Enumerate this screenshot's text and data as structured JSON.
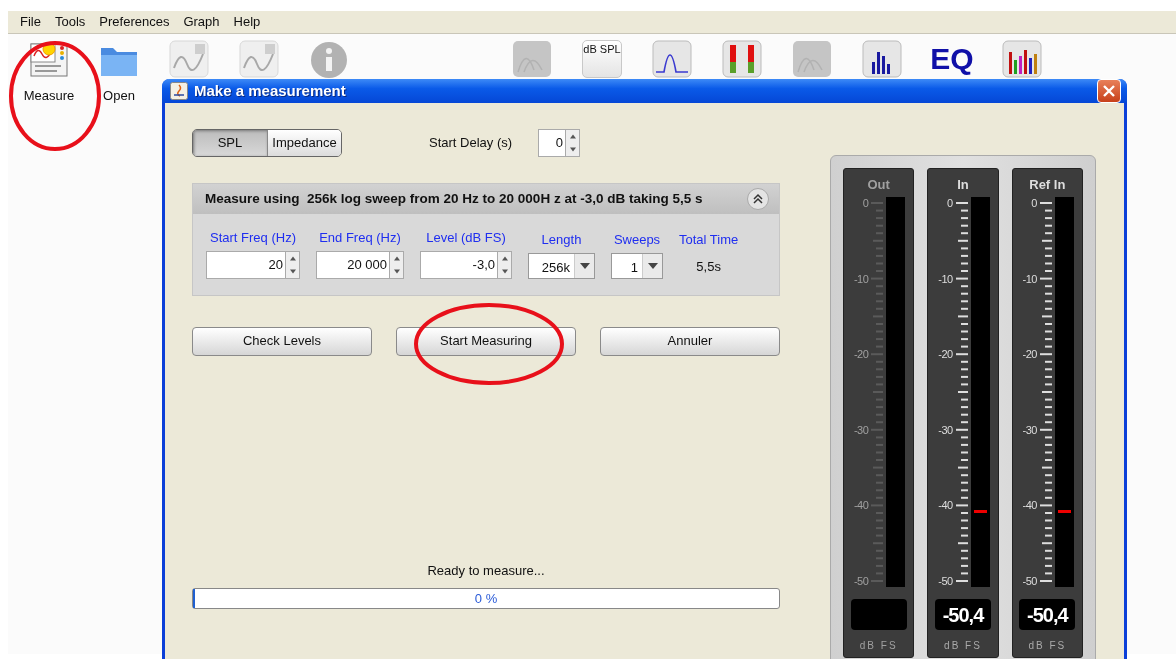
{
  "menu": [
    "File",
    "Tools",
    "Preferences",
    "Graph",
    "Help"
  ],
  "toolbar": [
    {
      "kind": "measure",
      "label": "Measure",
      "disabled": false,
      "circled": true
    },
    {
      "kind": "folder",
      "label": "Open",
      "disabled": false,
      "circled": false
    },
    {
      "kind": "graph",
      "disabled": true,
      "circled": false
    },
    {
      "kind": "graph",
      "disabled": true,
      "circled": false
    },
    {
      "kind": "info",
      "disabled": true,
      "circled": false
    },
    {
      "kind": "waterfall",
      "disabled": true,
      "circled": false
    },
    {
      "kind": "spl",
      "text": "dB SPL",
      "disabled": false,
      "circled": false
    },
    {
      "kind": "curve",
      "disabled": false,
      "circled": false
    },
    {
      "kind": "meter",
      "disabled": false,
      "circled": false
    },
    {
      "kind": "waterfall",
      "disabled": true,
      "circled": false
    },
    {
      "kind": "bars",
      "disabled": false,
      "circled": false
    },
    {
      "kind": "eq",
      "text": "EQ",
      "disabled": false,
      "circled": false
    },
    {
      "kind": "colorbars",
      "disabled": false,
      "circled": false
    }
  ],
  "dialog": {
    "title": "Make a measurement",
    "mode_tabs": [
      {
        "label": "SPL",
        "selected": true
      },
      {
        "label": "Impedance",
        "selected": false
      }
    ],
    "start_delay": {
      "label": "Start Delay (s)",
      "value": "0"
    },
    "sweep_panel": {
      "summary": "Measure using  256k log sweep from 20 Hz to 20 000H z at -3,0 dB taking 5,5 s",
      "expanded": true,
      "fields": [
        {
          "kind": "spinner",
          "label": "Start Freq (Hz)",
          "value": "20"
        },
        {
          "kind": "spinner",
          "label": "End Freq (Hz)",
          "value": "20 000"
        },
        {
          "kind": "spinner",
          "label": "Level (dB FS)",
          "value": "-3,0"
        },
        {
          "kind": "dropdown",
          "label": "Length",
          "value": "256k"
        },
        {
          "kind": "dropdown",
          "label": "Sweeps",
          "value": "1"
        },
        {
          "kind": "readout",
          "label": "Total Time",
          "value": "5,5s"
        }
      ]
    },
    "buttons": [
      {
        "label": "Check Levels",
        "circled": false
      },
      {
        "label": "Start Measuring",
        "circled": true
      },
      {
        "label": "Annuler",
        "circled": false
      }
    ],
    "status": "Ready to measure...",
    "progress": {
      "level": 0,
      "text": "0 %"
    },
    "meters": [
      {
        "title": "Out",
        "active": false,
        "scale": [
          "0",
          "-10",
          "-20",
          "-30",
          "-40",
          "-50"
        ],
        "unit": "dB FS"
      },
      {
        "title": "In",
        "active": true,
        "scale": [
          "0",
          "-10",
          "-20",
          "-30",
          "-40",
          "-50"
        ],
        "level": 0.18,
        "reading": "-50,4",
        "unit": "dB FS"
      },
      {
        "title": "Ref In",
        "active": true,
        "scale": [
          "0",
          "-10",
          "-20",
          "-30",
          "-40",
          "-50"
        ],
        "level": 0.18,
        "reading": "-50,4",
        "unit": "dB FS"
      }
    ]
  }
}
